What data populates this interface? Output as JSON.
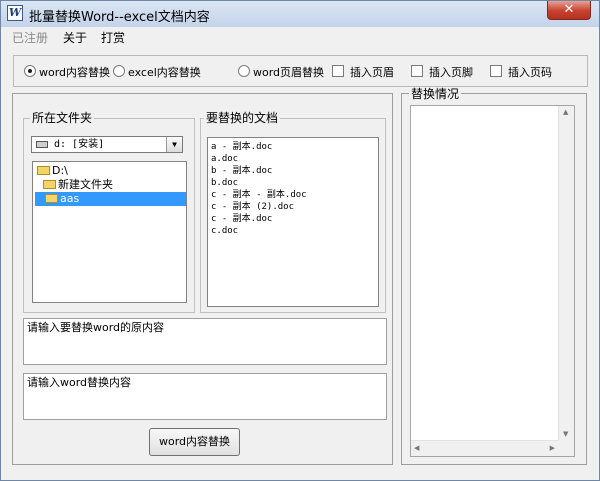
{
  "window": {
    "title": "批量替换Word--excel文档内容",
    "app_icon_letter": "W",
    "close_symbol": "✕"
  },
  "menu": {
    "items": [
      "已注册",
      "关于",
      "打赏"
    ]
  },
  "mode_options": {
    "word_content": "word内容替换",
    "excel_content": "excel内容替换",
    "word_header": "word页眉替换",
    "selected": "word_content"
  },
  "insert_options": {
    "header": "插入页眉",
    "footer": "插入页脚",
    "page_number": "插入页码"
  },
  "folder_panel": {
    "label": "所在文件夹",
    "drive": "d: [安装]",
    "tree": [
      "D:\\",
      "新建文件夹",
      "aas"
    ],
    "selected_index": 2
  },
  "docs_panel": {
    "label": "要替换的文档",
    "files": [
      "a - 副本.doc",
      "a.doc",
      "b - 副本.doc",
      "b.doc",
      "c - 副本 - 副本.doc",
      "c - 副本 (2).doc",
      "c - 副本.doc",
      "c.doc"
    ]
  },
  "inputs": {
    "original_text": "请输入要替换word的原内容",
    "replacement_text": "请输入word替换内容"
  },
  "action_button": "word内容替换",
  "result_panel": {
    "label": "替换情况"
  },
  "colors": {
    "titlebar": "#c3d3ea",
    "selection": "#3399ff",
    "close_button": "#c7412f"
  }
}
